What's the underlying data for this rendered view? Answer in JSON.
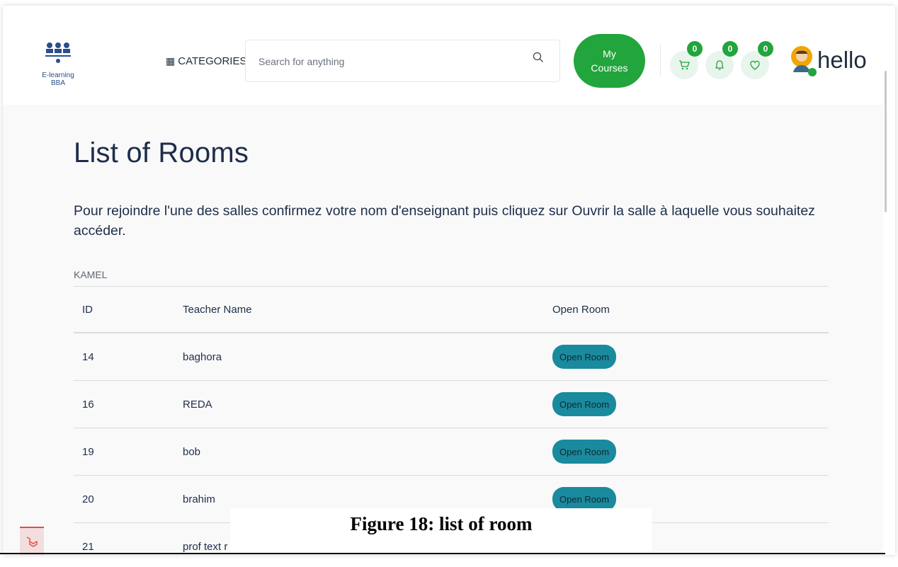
{
  "header": {
    "logo_text": "E-learning BBA",
    "categories_label": "CATEGORIES",
    "search_placeholder": "Search for anything",
    "my_courses_line1": "My",
    "my_courses_line2": "Courses",
    "cart_count": "0",
    "notification_count": "0",
    "wishlist_count": "0",
    "user_name": "hello"
  },
  "main": {
    "title": "List of Rooms",
    "intro": "Pour rejoindre l'une des salles confirmez votre nom d'enseignant puis cliquez sur Ouvrir la salle à laquelle vous souhaitez accéder.",
    "teacher_label": "KAMEL",
    "table": {
      "headers": [
        "ID",
        "Teacher Name",
        "Open Room"
      ],
      "rows": [
        {
          "id": "14",
          "name": "baghora",
          "action": "Open Room"
        },
        {
          "id": "16",
          "name": "REDA",
          "action": "Open Room"
        },
        {
          "id": "19",
          "name": "bob",
          "action": "Open Room"
        },
        {
          "id": "20",
          "name": "brahim",
          "action": "Open Room"
        },
        {
          "id": "21",
          "name": "prof text r",
          "action": ""
        }
      ]
    }
  },
  "caption": "Figure 18: list of room",
  "colors": {
    "accent_green": "#22a53c",
    "open_room_teal": "#1a8a9e",
    "text_dark": "#1d2e4a"
  }
}
